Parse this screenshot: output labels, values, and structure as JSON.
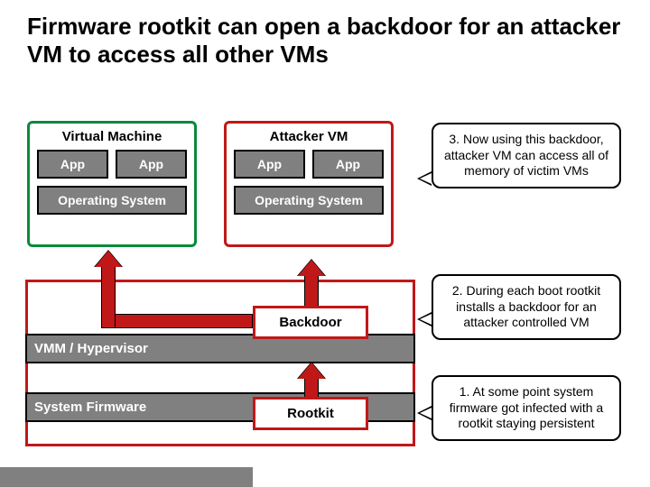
{
  "title": "Firmware rootkit can open a backdoor for an attacker VM to access all other VMs",
  "vm_victim": {
    "label": "Virtual Machine",
    "apps": [
      "App",
      "App"
    ],
    "os": "Operating System"
  },
  "vm_attacker": {
    "label": "Attacker VM",
    "apps": [
      "App",
      "App"
    ],
    "os": "Operating System"
  },
  "hypervisor": {
    "vmm": "VMM / Hypervisor",
    "firmware": "System Firmware"
  },
  "badges": {
    "backdoor": "Backdoor",
    "rootkit": "Rootkit"
  },
  "callouts": {
    "step3": "3. Now using this backdoor, attacker VM can access all of memory of victim VMs",
    "step2": "2. During each boot rootkit installs a backdoor for an attacker controlled VM",
    "step1": "1. At some point system firmware got infected with a rootkit staying persistent"
  },
  "colors": {
    "attack_red": "#c01818",
    "victim_green": "#0a8a3a",
    "panel_gray": "#808080"
  }
}
